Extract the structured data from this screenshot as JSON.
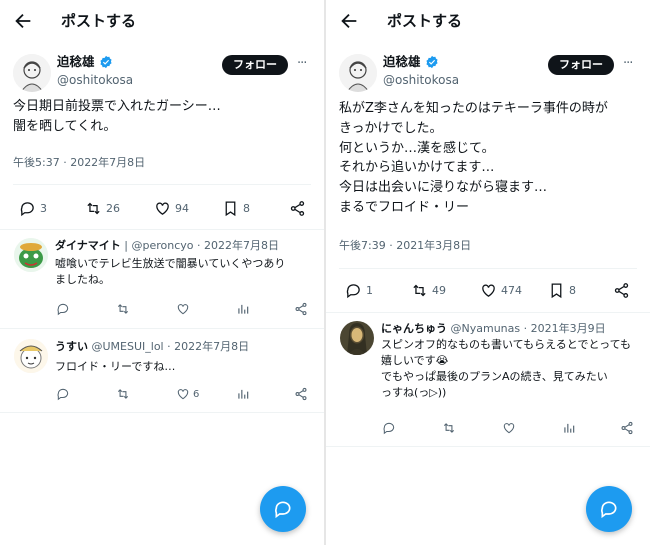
{
  "colors": {
    "accent": "#1d9bf0",
    "text": "#0f1419",
    "muted": "#536471",
    "follow_bg": "#0f1419"
  },
  "left": {
    "header": {
      "title": "ポストする"
    },
    "author": {
      "name": "迫稔雄",
      "handle": "@oshitokosa",
      "follow_label": "フォロー",
      "more": "···"
    },
    "post": {
      "text": "今日期日前投票で入れたガーシー…\n闇を晒してくれ。",
      "timestamp": "午後5:37 · 2022年7月8日"
    },
    "stats": {
      "replies": "3",
      "reposts": "26",
      "likes": "94",
      "bookmarks": "8"
    },
    "replies": [
      {
        "name": "ダイナマイト",
        "handle": "| @peroncyo",
        "date": "· 2022年7月8日",
        "text": "嘘喰いでテレビ生放送で闇暴いていくやつあり\nましたね。",
        "likes": ""
      },
      {
        "name": "うすい",
        "handle": "@UMESUI_lol",
        "date": "· 2022年7月8日",
        "text": "フロイド・リーですね…",
        "likes": "6"
      }
    ]
  },
  "right": {
    "header": {
      "title": "ポストする"
    },
    "author": {
      "name": "迫稔雄",
      "handle": "@oshitokosa",
      "follow_label": "フォロー",
      "more": "···"
    },
    "post": {
      "text": "私がZ李さんを知ったのはテキーラ事件の時が\nきっかけでした。\n何というか…漢を感じて。\nそれから追いかけてます…\n今日は出会いに浸りながら寝ます…\nまるでフロイド・リー",
      "timestamp": "午後7:39 · 2021年3月8日"
    },
    "stats": {
      "replies": "1",
      "reposts": "49",
      "likes": "474",
      "bookmarks": "8"
    },
    "replies": [
      {
        "name": "にゃんちゅう",
        "handle": "@Nyamunas",
        "date": "· 2021年3月9日",
        "text": "スピンオフ的なものも書いてもらえるとでとっても嬉しいです😭\nでもやっぱ最後のプランAの続き、見てみたい\nっすね(っ▷))"
      }
    ]
  }
}
